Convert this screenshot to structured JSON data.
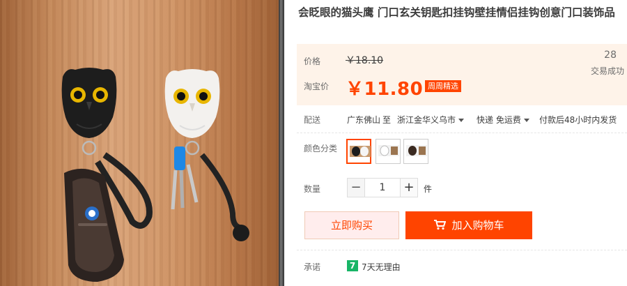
{
  "product": {
    "title": "会眨眼的猫头鹰 门口玄关钥匙扣挂钩壁挂情侣挂钩创意门口装饰品"
  },
  "price": {
    "label": "价格",
    "original": "￥18.10",
    "promo_label": "淘宝价",
    "promo": "￥11.80",
    "promo_tag": "周周精选",
    "sales_count": "28",
    "sales_label": "交易成功",
    "accent_color": "#ff4400"
  },
  "shipping": {
    "label": "配送",
    "from": "广东佛山",
    "to_word": "至",
    "destination": "浙江金华义乌市",
    "method": "快递 免运费",
    "dispatch": "付款后48小时内发货"
  },
  "color": {
    "label": "颜色分类",
    "options": [
      "black-white-owl",
      "white-owl",
      "black-owl"
    ],
    "selected_index": 0
  },
  "quantity": {
    "label": "数量",
    "value": "1",
    "unit": "件",
    "minus": "−",
    "plus": "+"
  },
  "actions": {
    "buy_now": "立即购买",
    "add_to_cart": "加入购物车",
    "cart_icon": "cart-icon"
  },
  "promise": {
    "label": "承诺",
    "badge": "7",
    "text": "7天无理由",
    "badge_color": "#18b566"
  }
}
